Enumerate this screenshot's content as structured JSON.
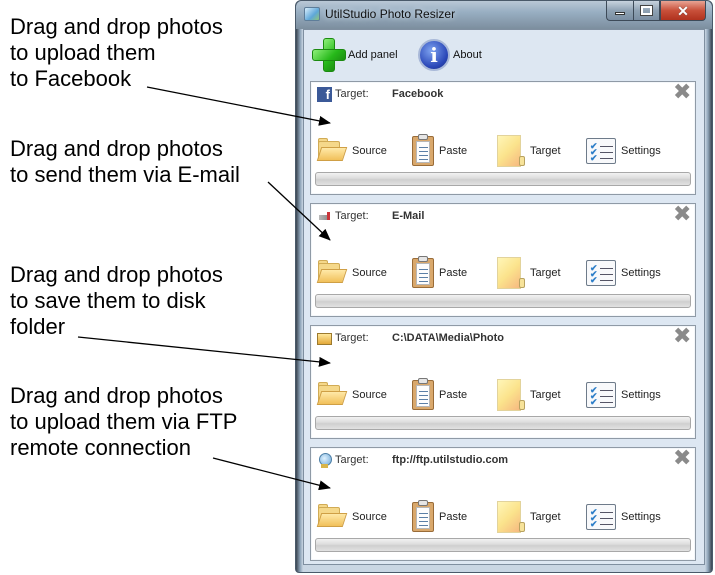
{
  "annotations": [
    "Drag and drop photos\nto upload them\nto Facebook",
    "Drag and drop photos\nto send them via E-mail",
    "Drag and drop photos\nto save them to disk\nfolder",
    "Drag and drop photos\nto upload them via FTP\nremote connection"
  ],
  "window": {
    "title": "UtilStudio Photo Resizer",
    "icon": "app-photo-icon",
    "controls": {
      "minimize": "minimize-icon",
      "maximize": "maximize-icon",
      "close": "close-icon",
      "close_glyph": "✕"
    }
  },
  "toolbar": {
    "add_panel": {
      "label": "Add panel",
      "icon": "green-plus-icon"
    },
    "about": {
      "label": "About",
      "icon": "info-icon",
      "glyph": "i"
    }
  },
  "panels": [
    {
      "target_label": "Target:",
      "target_value": "Facebook",
      "target_icon": "facebook-icon",
      "icon_glyph": "f",
      "close_glyph": "✖",
      "actions": {
        "source": "Source",
        "paste": "Paste",
        "target": "Target",
        "settings": "Settings"
      },
      "progress": 0
    },
    {
      "target_label": "Target:",
      "target_value": "E-Mail",
      "target_icon": "email-icon",
      "icon_glyph": "",
      "close_glyph": "✖",
      "actions": {
        "source": "Source",
        "paste": "Paste",
        "target": "Target",
        "settings": "Settings"
      },
      "progress": 0
    },
    {
      "target_label": "Target:",
      "target_value": "C:\\DATA\\Media\\Photo",
      "target_icon": "folder-icon",
      "icon_glyph": "",
      "close_glyph": "✖",
      "actions": {
        "source": "Source",
        "paste": "Paste",
        "target": "Target",
        "settings": "Settings"
      },
      "progress": 0
    },
    {
      "target_label": "Target:",
      "target_value": "ftp://ftp.utilstudio.com",
      "target_icon": "ftp-globe-icon",
      "icon_glyph": "",
      "close_glyph": "✖",
      "actions": {
        "source": "Source",
        "paste": "Paste",
        "target": "Target",
        "settings": "Settings"
      },
      "progress": 0
    }
  ],
  "settings_checks": [
    "✔",
    "✔",
    "✔"
  ]
}
